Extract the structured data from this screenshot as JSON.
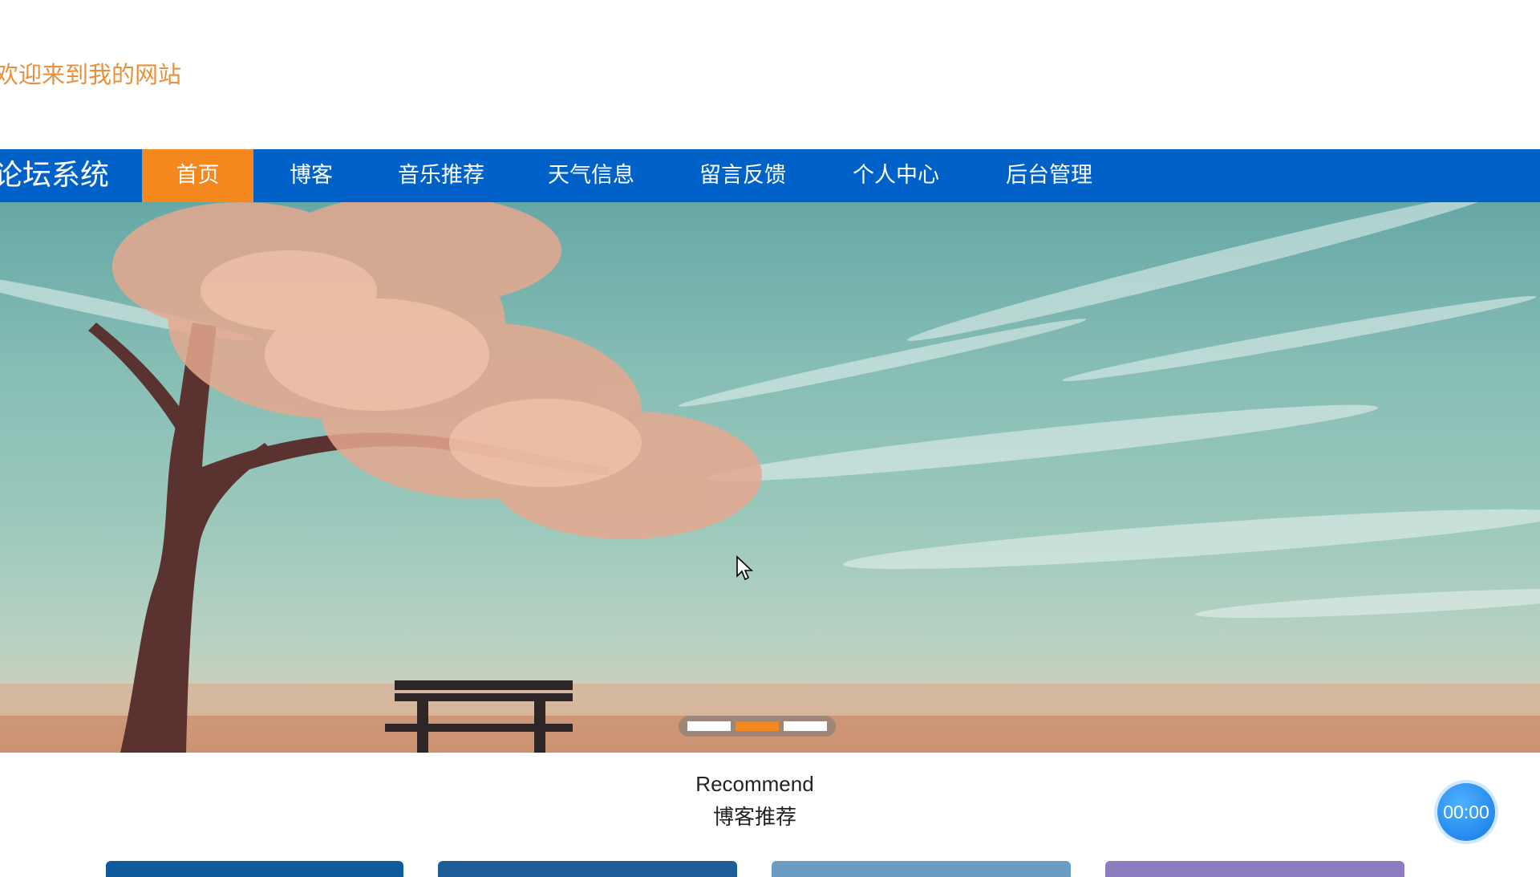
{
  "header": {
    "welcome_text": "欢迎来到我的网站"
  },
  "nav": {
    "brand": "论坛系统",
    "items": [
      {
        "label": "首页",
        "active": true
      },
      {
        "label": "博客",
        "active": false
      },
      {
        "label": "音乐推荐",
        "active": false
      },
      {
        "label": "天气信息",
        "active": false
      },
      {
        "label": "留言反馈",
        "active": false
      },
      {
        "label": "个人中心",
        "active": false
      },
      {
        "label": "后台管理",
        "active": false
      }
    ]
  },
  "carousel": {
    "slide_count": 3,
    "active_index": 1
  },
  "section": {
    "title_en": "Recommend",
    "title_cn": "博客推荐"
  },
  "player": {
    "time": "00:00"
  },
  "colors": {
    "nav_bg": "#0062c8",
    "accent": "#f5871f",
    "welcome": "#e8913a"
  }
}
